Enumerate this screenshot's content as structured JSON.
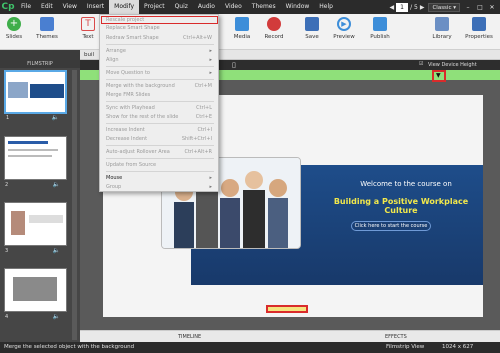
{
  "menubar": {
    "app_logo": "Cp",
    "items": [
      "File",
      "Edit",
      "View",
      "Insert",
      "Modify",
      "Project",
      "Quiz",
      "Audio",
      "Video",
      "Themes",
      "Window",
      "Help"
    ],
    "page_current": "1",
    "page_total": "/ 5",
    "theme": "Classic"
  },
  "toolbar": {
    "slides": "Slides",
    "themes": "Themes",
    "text": "Text",
    "media": "Media",
    "record": "Record",
    "save": "Save",
    "preview": "Preview",
    "publish": "Publish",
    "library": "Library",
    "properties": "Properties"
  },
  "tab": "buil",
  "filmstrip": {
    "title": "FILMSTRIP",
    "numbers": [
      "1",
      "2",
      "3",
      "4"
    ]
  },
  "stage": {
    "view_device_height": "View Device Height",
    "welcome": "Welcome to the course on",
    "course_title": "Building a Positive Workplace Culture",
    "start_button": "Click here to start the course",
    "timeline": "TIMELINE",
    "effects": "EFFECTS"
  },
  "dropdown": {
    "items": [
      {
        "label": "Rescale project",
        "shortcut": ""
      },
      {
        "label": "Replace Smart Shape",
        "shortcut": ""
      },
      {
        "label": "Redraw Smart Shape",
        "shortcut": "Ctrl+Alt+W"
      },
      {
        "label": "Arrange",
        "shortcut": ""
      },
      {
        "label": "Align",
        "shortcut": ""
      },
      {
        "label": "Move Question to",
        "shortcut": ""
      },
      {
        "label": "Merge with the background",
        "shortcut": "Ctrl+M"
      },
      {
        "label": "Merge FMR Slides",
        "shortcut": ""
      },
      {
        "label": "Sync with Playhead",
        "shortcut": "Ctrl+L"
      },
      {
        "label": "Show for the rest of the slide",
        "shortcut": "Ctrl+E"
      },
      {
        "label": "Increase Indent",
        "shortcut": "Ctrl+I"
      },
      {
        "label": "Decrease Indent",
        "shortcut": "Shift+Ctrl+I"
      },
      {
        "label": "Auto-adjust Rollover Area",
        "shortcut": "Ctrl+Alt+R"
      },
      {
        "label": "Update from Source",
        "shortcut": ""
      },
      {
        "label": "Mouse",
        "shortcut": ""
      },
      {
        "label": "Group",
        "shortcut": ""
      }
    ]
  },
  "statusbar": {
    "message": "Merge the selected object with the background",
    "view": "Filmstrip View",
    "size": "1024 x 627"
  }
}
